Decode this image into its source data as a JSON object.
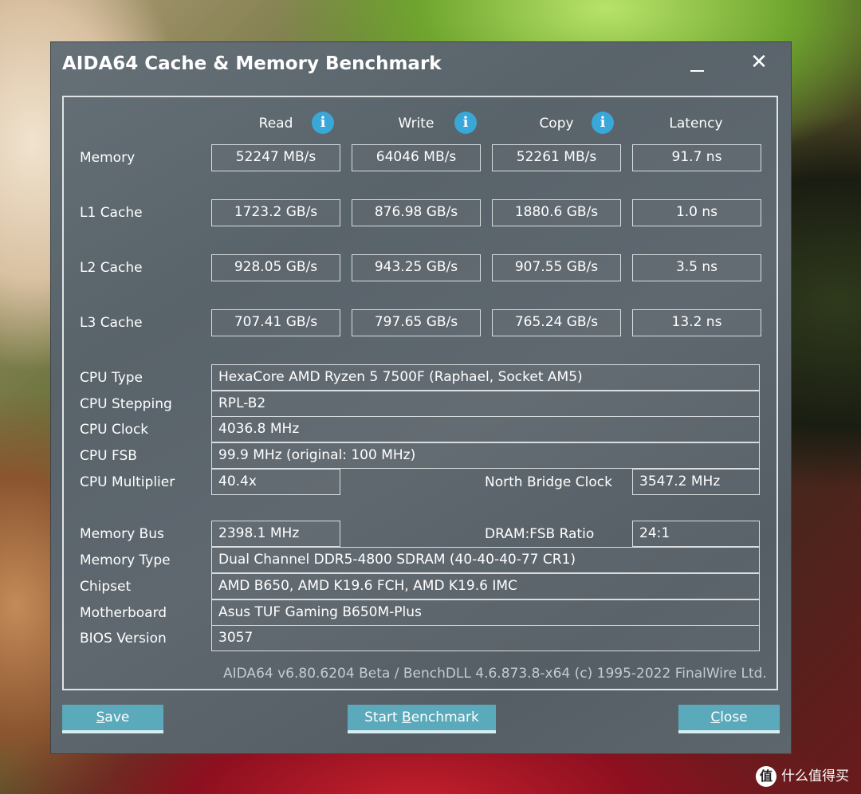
{
  "window": {
    "title": "AIDA64 Cache & Memory Benchmark",
    "close_glyph": "✕"
  },
  "columns": {
    "read": "Read",
    "write": "Write",
    "copy": "Copy",
    "latency": "Latency",
    "info_glyph": "i"
  },
  "rows": {
    "memory": {
      "label": "Memory",
      "read": "52247 MB/s",
      "write": "64046 MB/s",
      "copy": "52261 MB/s",
      "latency": "91.7 ns"
    },
    "l1": {
      "label": "L1 Cache",
      "read": "1723.2 GB/s",
      "write": "876.98 GB/s",
      "copy": "1880.6 GB/s",
      "latency": "1.0 ns"
    },
    "l2": {
      "label": "L2 Cache",
      "read": "928.05 GB/s",
      "write": "943.25 GB/s",
      "copy": "907.55 GB/s",
      "latency": "3.5 ns"
    },
    "l3": {
      "label": "L3 Cache",
      "read": "707.41 GB/s",
      "write": "797.65 GB/s",
      "copy": "765.24 GB/s",
      "latency": "13.2 ns"
    }
  },
  "info": {
    "cpu_type": {
      "label": "CPU Type",
      "value": "HexaCore AMD Ryzen 5 7500F  (Raphael, Socket AM5)"
    },
    "cpu_stepping": {
      "label": "CPU Stepping",
      "value": "RPL-B2"
    },
    "cpu_clock": {
      "label": "CPU Clock",
      "value": "4036.8 MHz"
    },
    "cpu_fsb": {
      "label": "CPU FSB",
      "value": "99.9 MHz  (original: 100 MHz)"
    },
    "cpu_multiplier": {
      "label": "CPU Multiplier",
      "value": "40.4x"
    },
    "north_bridge_clock": {
      "label": "North Bridge Clock",
      "value": "3547.2 MHz"
    },
    "memory_bus": {
      "label": "Memory Bus",
      "value": "2398.1 MHz"
    },
    "dram_fsb_ratio": {
      "label": "DRAM:FSB Ratio",
      "value": "24:1"
    },
    "memory_type": {
      "label": "Memory Type",
      "value": "Dual Channel DDR5-4800 SDRAM  (40-40-40-77 CR1)"
    },
    "chipset": {
      "label": "Chipset",
      "value": "AMD B650, AMD K19.6 FCH, AMD K19.6 IMC"
    },
    "motherboard": {
      "label": "Motherboard",
      "value": "Asus TUF Gaming B650M-Plus"
    },
    "bios_version": {
      "label": "BIOS Version",
      "value": "3057"
    }
  },
  "footer": "AIDA64 v6.80.6204 Beta / BenchDLL 4.6.873.8-x64  (c) 1995-2022 FinalWire Ltd.",
  "buttons": {
    "save": {
      "hotkey": "S",
      "rest": "ave"
    },
    "start": {
      "before": "Start ",
      "hotkey": "B",
      "rest": "enchmark"
    },
    "close": {
      "hotkey": "C",
      "rest": "lose"
    }
  },
  "watermark": {
    "logo": "值",
    "text": "什么值得买"
  }
}
